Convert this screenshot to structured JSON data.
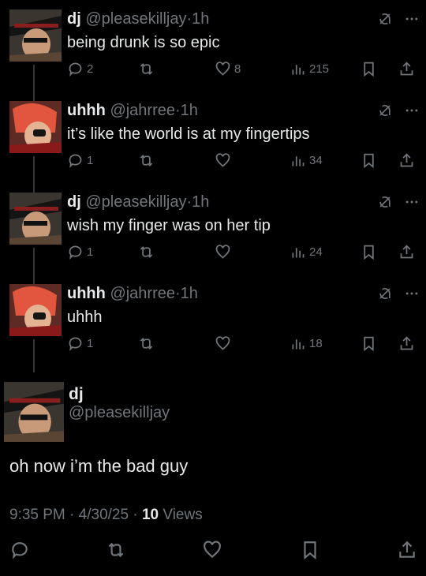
{
  "thread": [
    {
      "name": "dj",
      "handle": "@pleasekilljay",
      "time": "1h",
      "text": "being drunk is so epic",
      "replies": "2",
      "reposts": "",
      "likes": "8",
      "views": "215",
      "avatar": "dj-avatar"
    },
    {
      "name": "uhhh",
      "handle": "@jahrree",
      "time": "1h",
      "text": "it’s like the world is at my fingertips",
      "replies": "1",
      "reposts": "",
      "likes": "",
      "views": "34",
      "avatar": "uhhh-avatar"
    },
    {
      "name": "dj",
      "handle": "@pleasekilljay",
      "time": "1h",
      "text": "wish my finger was on her tip",
      "replies": "1",
      "reposts": "",
      "likes": "",
      "views": "24",
      "avatar": "dj-avatar"
    },
    {
      "name": "uhhh",
      "handle": "@jahrree",
      "time": "1h",
      "text": "uhhh",
      "replies": "1",
      "reposts": "",
      "likes": "",
      "views": "18",
      "avatar": "uhhh-avatar"
    }
  ],
  "separator": "·",
  "main_tweet": {
    "name": "dj",
    "handle": "@pleasekilljay",
    "text": "oh now i’m the bad guy",
    "time": "9:35 PM",
    "date": "4/30/25",
    "views_count": "10",
    "views_label": "Views"
  },
  "icons": {
    "grok": "grok-slash-icon",
    "more": "more-icon",
    "reply": "reply-icon",
    "repost": "repost-icon",
    "like": "heart-icon",
    "views": "views-bar-icon",
    "bookmark": "bookmark-icon",
    "share": "share-icon"
  },
  "colors": {
    "background": "#000000",
    "text_primary": "#e7e9ea",
    "text_secondary": "#71767b",
    "thread_line": "#333639"
  }
}
